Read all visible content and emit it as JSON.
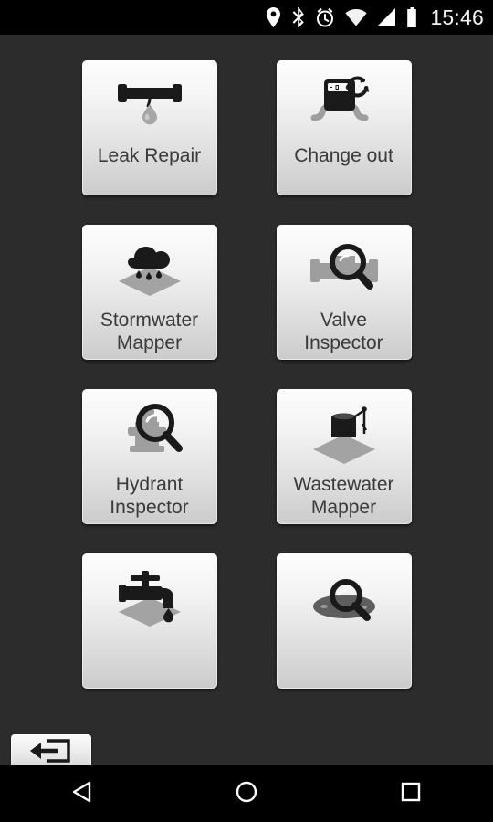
{
  "status_bar": {
    "icons": [
      "location-pin-icon",
      "bluetooth-icon",
      "alarm-clock-icon",
      "wifi-icon",
      "cell-signal-icon",
      "battery-icon"
    ],
    "time": "15:46"
  },
  "colors": {
    "background": "#2b2b2b",
    "tile_top": "#fdfdfd",
    "tile_bottom": "#cbcbcb",
    "label_text": "#3a3a3a",
    "icon_dark": "#1a1a1a",
    "icon_gray": "#9e9e9e",
    "status_bar": "#000000"
  },
  "grid": {
    "tiles": [
      {
        "id": "leak-repair",
        "label": "Leak Repair",
        "icon": "pipe-leak-icon"
      },
      {
        "id": "change-out",
        "label": "Change out",
        "icon": "meter-swap-icon"
      },
      {
        "id": "stormwater-mapper",
        "label": "Stormwater Mapper",
        "icon": "rain-cloud-map-icon"
      },
      {
        "id": "valve-inspector",
        "label": "Valve Inspector",
        "icon": "valve-magnifier-icon"
      },
      {
        "id": "hydrant-inspector",
        "label": "Hydrant Inspector",
        "icon": "hydrant-magnifier-icon"
      },
      {
        "id": "wastewater-mapper",
        "label": "Wastewater Mapper",
        "icon": "manhole-map-icon"
      },
      {
        "id": "water-mapper",
        "label": "",
        "icon": "faucet-map-icon"
      },
      {
        "id": "manhole-inspector",
        "label": "",
        "icon": "manhole-magnifier-icon"
      }
    ]
  },
  "exit_button": {
    "icon": "exit-arrow-icon",
    "label": ""
  },
  "nav_bar": {
    "back": "back-triangle-icon",
    "home": "home-circle-icon",
    "recents": "recents-square-icon"
  }
}
